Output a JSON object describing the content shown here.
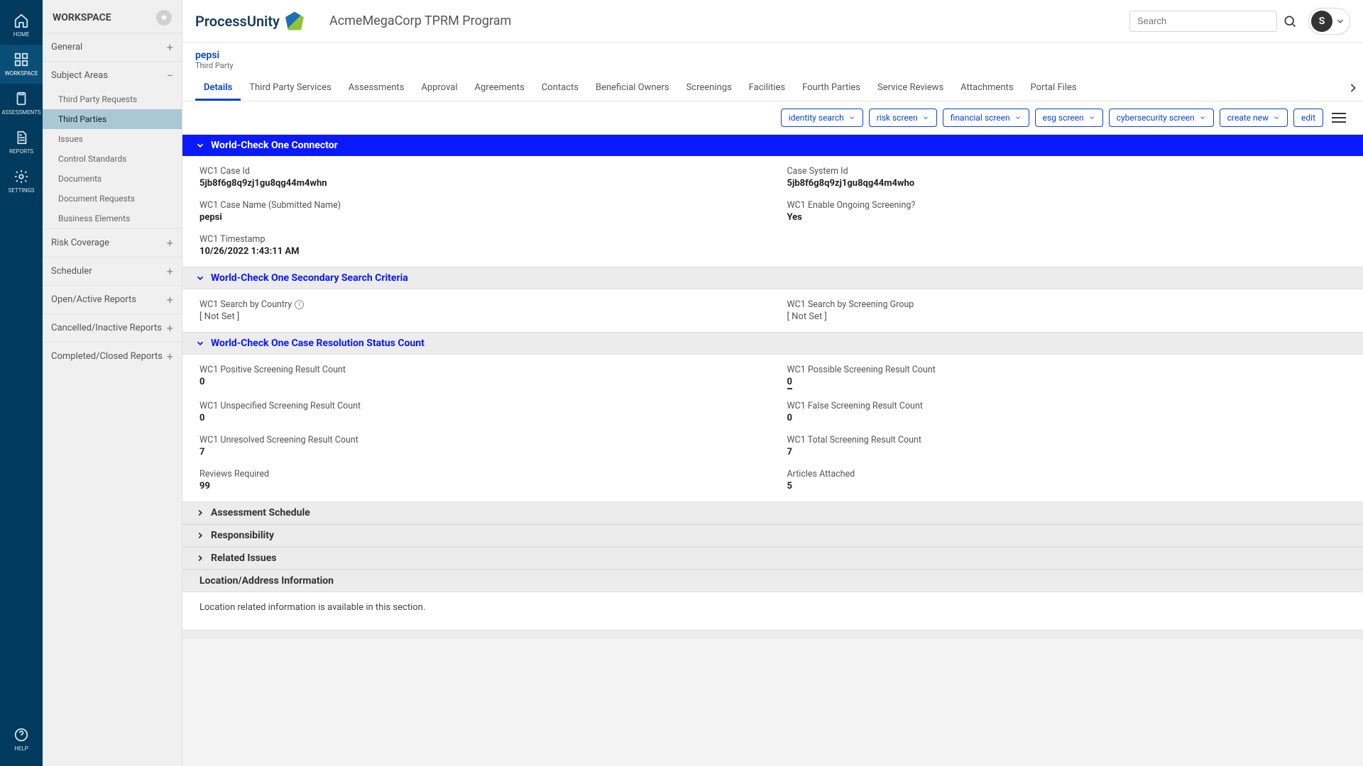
{
  "rail": {
    "items": [
      {
        "label": "HOME"
      },
      {
        "label": "WORKSPACE"
      },
      {
        "label": "ASSESSMENTS"
      },
      {
        "label": "REPORTS"
      },
      {
        "label": "SETTINGS"
      }
    ],
    "help": "HELP"
  },
  "sidebar": {
    "title": "WORKSPACE",
    "groups": [
      {
        "label": "General"
      },
      {
        "label": "Subject Areas",
        "open": true,
        "children": [
          "Third Party Requests",
          "Third Parties",
          "Issues",
          "Control Standards",
          "Documents",
          "Document Requests",
          "Business Elements"
        ],
        "active_index": 1
      },
      {
        "label": "Risk Coverage"
      },
      {
        "label": "Scheduler"
      },
      {
        "label": "Open/Active Reports"
      },
      {
        "label": "Cancelled/Inactive Reports"
      },
      {
        "label": "Completed/Closed Reports"
      }
    ]
  },
  "header": {
    "brand": "ProcessUnity",
    "program": "AcmeMegaCorp TPRM Program",
    "search_placeholder": "Search",
    "avatar_initial": "S"
  },
  "record": {
    "title": "pepsi",
    "subtitle": "Third Party"
  },
  "tabs": [
    "Details",
    "Third Party Services",
    "Assessments",
    "Approval",
    "Agreements",
    "Contacts",
    "Beneficial Owners",
    "Screenings",
    "Facilities",
    "Fourth Parties",
    "Service Reviews",
    "Attachments",
    "Portal Files"
  ],
  "active_tab": 0,
  "actions": [
    "identity search",
    "risk screen",
    "financial screen",
    "esg screen",
    "cybersecurity screen",
    "create new",
    "edit"
  ],
  "sections": {
    "connector": {
      "title": "World-Check One Connector",
      "fields": {
        "case_id_label": "WC1 Case Id",
        "case_id": "5jb8f6g8q9zj1gu8qg44m4whn",
        "system_id_label": "Case System Id",
        "system_id": "5jb8f6g8q9zj1gu8qg44m4who",
        "case_name_label": "WC1 Case Name (Submitted Name)",
        "case_name": "pepsi",
        "ongoing_label": "WC1 Enable Ongoing Screening?",
        "ongoing": "Yes",
        "ts_label": "WC1 Timestamp",
        "ts": "10/26/2022 1:43:11 AM"
      }
    },
    "secondary": {
      "title": "World-Check One Secondary Search Criteria",
      "country_label": "WC1 Search by Country",
      "country_val": "[ Not Set ]",
      "group_label": "WC1 Search by Screening Group",
      "group_val": "[ Not Set ]"
    },
    "resolution": {
      "title": "World-Check One Case Resolution Status Count",
      "positive_label": "WC1 Positive Screening Result Count",
      "positive": "0",
      "possible_label": "WC1 Possible Screening Result Count",
      "possible": "0",
      "unspec_label": "WC1 Unspecified Screening Result Count",
      "unspec": "0",
      "false_label": "WC1 False Screening Result Count",
      "false": "0",
      "unres_label": "WC1 Unresolved Screening Result Count",
      "unres": "7",
      "total_label": "WC1 Total Screening Result Count",
      "total": "7",
      "reviews_label": "Reviews Required",
      "reviews": "99",
      "articles_label": "Articles Attached",
      "articles": "5"
    },
    "collapsed": [
      "Assessment Schedule",
      "Responsibility",
      "Related Issues"
    ],
    "location": {
      "title": "Location/Address Information",
      "text": "Location related information is available in this section."
    }
  }
}
